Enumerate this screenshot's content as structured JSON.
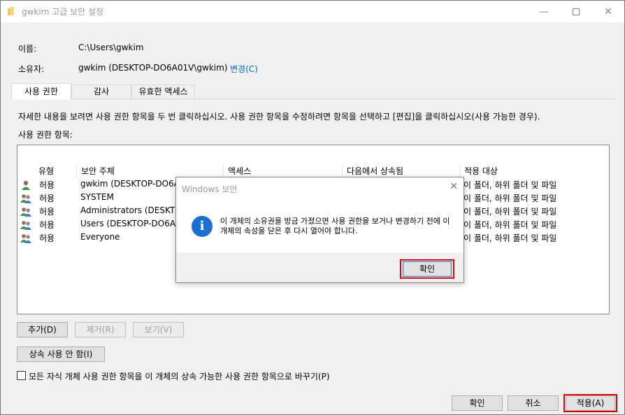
{
  "window": {
    "title": "gwkim 고급 보안 설정"
  },
  "owner_info": {
    "name_label": "이름:",
    "name_value": "C:\\Users\\gwkim",
    "owner_label": "소유자:",
    "owner_value": "gwkim (DESKTOP-DO6A01V\\gwkim)",
    "change_link": "변경(C)"
  },
  "tabs": [
    {
      "label": "사용 권한",
      "active": true
    },
    {
      "label": "감사",
      "active": false
    },
    {
      "label": "유효한 액세스",
      "active": false
    }
  ],
  "permissions": {
    "instructions": "자세한 내용을 보려면 사용 권한 항목을 두 번 클릭하십시오. 사용 권한 항목을 수정하려면 항목을 선택하고 [편집]을 클릭하십시오(사용 가능한 경우).",
    "entries_label": "사용 권한 항목:",
    "columns": [
      "유형",
      "보안 주체",
      "액세스",
      "다음에서 상속됨",
      "적용 대상"
    ],
    "rows": [
      {
        "icon": "single-user-icon",
        "type": "허용",
        "principal": "gwkim (DESKTOP-DO6A0",
        "applies": "이 폴더, 하위 폴더 및 파일"
      },
      {
        "icon": "user-group-icon",
        "type": "허용",
        "principal": "SYSTEM",
        "applies": "이 폴더, 하위 폴더 및 파일"
      },
      {
        "icon": "user-group-icon",
        "type": "허용",
        "principal": "Administrators (DESKTOP",
        "applies": "이 폴더, 하위 폴더 및 파일"
      },
      {
        "icon": "user-group-icon",
        "type": "허용",
        "principal": "Users (DESKTOP-DO6A01",
        "applies": "이 폴더, 하위 폴더 및 파일"
      },
      {
        "icon": "user-group-icon",
        "type": "허용",
        "principal": "Everyone",
        "applies": "이 폴더, 하위 폴더 및 파일"
      }
    ],
    "add_button": "추가(D)",
    "remove_button": "제거(R)",
    "view_button": "보기(V)",
    "disable_inheritance_button": "상속 사용 안 함(I)",
    "replace_checkbox_label": "모든 자식 개체 사용 권한 항목을 이 개체의 상속 가능한 사용 권한 항목으로 바꾸기(P)"
  },
  "footer": {
    "ok": "확인",
    "cancel": "취소",
    "apply": "적용(A)"
  },
  "dialog": {
    "title": "Windows 보안",
    "message": "이 개체의 소유권을 방금 가졌으면 사용 권한을 보거나 변경하기 전에 이 개체의 속성을 닫은 후 다시 열어야 합니다.",
    "ok": "확인"
  }
}
